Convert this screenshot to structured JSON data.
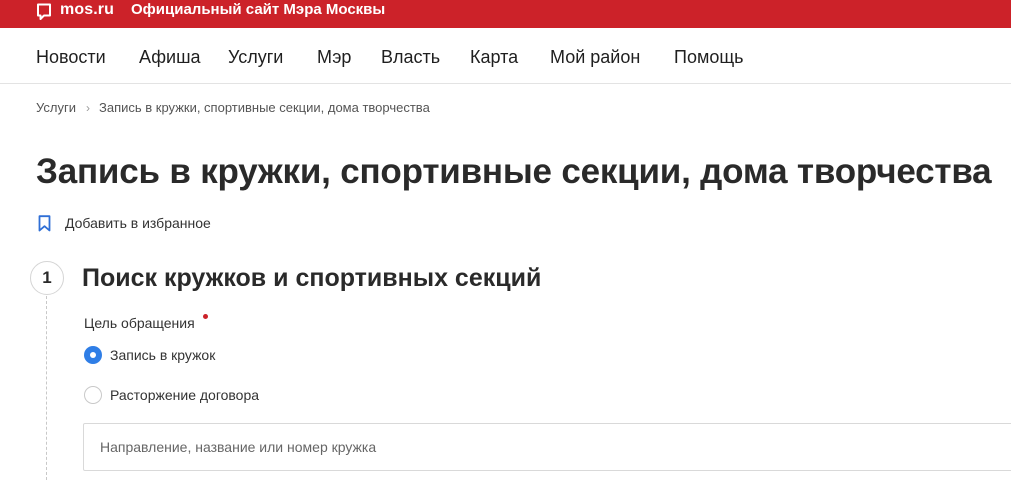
{
  "header": {
    "logo_text": "mos.ru",
    "site_title": "Официальный сайт Мэра Москвы",
    "brand_color": "#cc2229",
    "logo_icon": "speech-bubble-icon"
  },
  "nav": {
    "items": [
      {
        "label": "Новости"
      },
      {
        "label": "Афиша"
      },
      {
        "label": "Услуги"
      },
      {
        "label": "Мэр"
      },
      {
        "label": "Власть"
      },
      {
        "label": "Карта"
      },
      {
        "label": "Мой район"
      },
      {
        "label": "Помощь"
      }
    ]
  },
  "breadcrumb": {
    "items": [
      {
        "label": "Услуги"
      },
      {
        "label": "Запись в кружки, спортивные секции, дома творчества"
      }
    ],
    "separator": "›"
  },
  "page": {
    "title": "Запись в кружки, спортивные секции, дома творчества",
    "favorite_label": "Добавить в избранное",
    "favorite_icon": "bookmark-icon"
  },
  "step": {
    "number": "1",
    "title": "Поиск кружков и спортивных секций"
  },
  "form": {
    "purpose_label": "Цель обращения",
    "options": [
      {
        "label": "Запись в кружок",
        "selected": true
      },
      {
        "label": "Расторжение договора",
        "selected": false
      }
    ],
    "search": {
      "placeholder": "Направление, название или номер кружка",
      "value": ""
    },
    "accent_color": "#2f7ee6"
  }
}
